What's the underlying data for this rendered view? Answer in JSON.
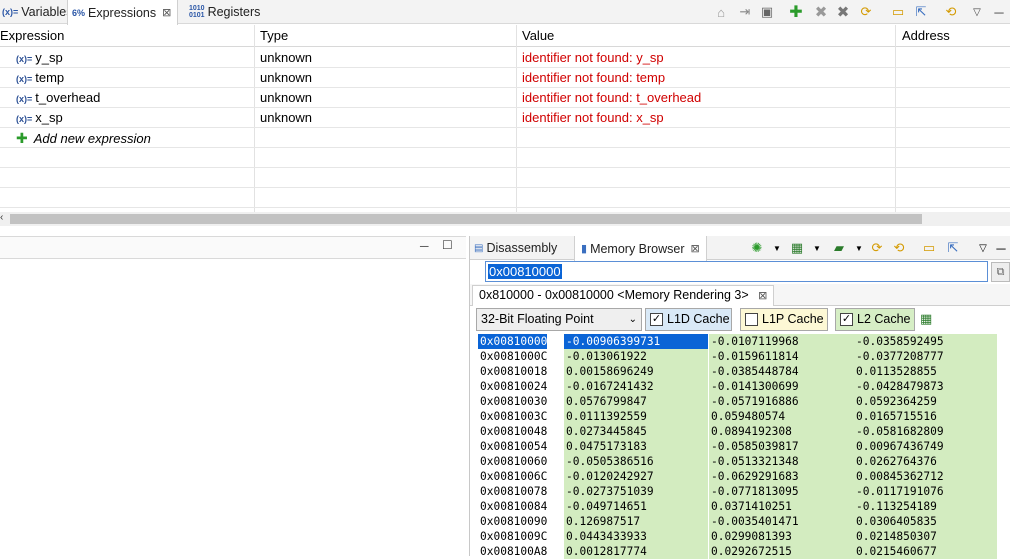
{
  "top_tabs": [
    {
      "label": "Variables"
    },
    {
      "label": "Expressions"
    },
    {
      "label": "Registers"
    }
  ],
  "expressions": {
    "columns": [
      "Expression",
      "Type",
      "Value",
      "Address"
    ],
    "rows": [
      {
        "name": "y_sp",
        "type": "unknown",
        "value": "identifier not found: y_sp"
      },
      {
        "name": "temp",
        "type": "unknown",
        "value": "identifier not found: temp"
      },
      {
        "name": "t_overhead",
        "type": "unknown",
        "value": "identifier not found: t_overhead"
      },
      {
        "name": "x_sp",
        "type": "unknown",
        "value": "identifier not found: x_sp"
      }
    ],
    "add_new": "Add new expression"
  },
  "memory": {
    "tabs": [
      {
        "label": "Disassembly"
      },
      {
        "label": "Memory Browser"
      }
    ],
    "address_input": "0x00810000",
    "rendering_tab": "0x810000 - 0x00810000 <Memory Rendering 3>",
    "format": "32-Bit Floating Point",
    "caches": [
      {
        "label": "L1D Cache",
        "checked": true
      },
      {
        "label": "L1P Cache",
        "checked": false
      },
      {
        "label": "L2 Cache",
        "checked": true
      }
    ],
    "rows": [
      {
        "addr": "0x00810000",
        "v": [
          "-0.00906399731",
          "-0.0107119968",
          "-0.0358592495"
        ]
      },
      {
        "addr": "0x0081000C",
        "v": [
          "-0.013061922",
          "-0.0159611814",
          "-0.0377208777"
        ]
      },
      {
        "addr": "0x00810018",
        "v": [
          "0.00158696249",
          "-0.0385448784",
          "0.0113528855"
        ]
      },
      {
        "addr": "0x00810024",
        "v": [
          "-0.0167241432",
          "-0.0141300699",
          "-0.0428479873"
        ]
      },
      {
        "addr": "0x00810030",
        "v": [
          "0.0576799847",
          "-0.0571916886",
          "0.0592364259"
        ]
      },
      {
        "addr": "0x0081003C",
        "v": [
          "0.0111392559",
          "0.059480574",
          "0.0165715516"
        ]
      },
      {
        "addr": "0x00810048",
        "v": [
          "0.0273445845",
          "0.0894192308",
          "-0.0581682809"
        ]
      },
      {
        "addr": "0x00810054",
        "v": [
          "0.0475173183",
          "-0.0585039817",
          "0.00967436749"
        ]
      },
      {
        "addr": "0x00810060",
        "v": [
          "-0.0505386516",
          "-0.0513321348",
          "0.0262764376"
        ]
      },
      {
        "addr": "0x0081006C",
        "v": [
          "-0.0120242927",
          "-0.0629291683",
          "0.00845362712"
        ]
      },
      {
        "addr": "0x00810078",
        "v": [
          "-0.0273751039",
          "-0.0771813095",
          "-0.0117191076"
        ]
      },
      {
        "addr": "0x00810084",
        "v": [
          "-0.049714651",
          "0.0371410251",
          "-0.113254189"
        ]
      },
      {
        "addr": "0x00810090",
        "v": [
          "0.126987517",
          "-0.0035401471",
          "0.0306405835"
        ]
      },
      {
        "addr": "0x0081009C",
        "v": [
          "0.0443433933",
          "0.0299081393",
          "0.0214850307"
        ]
      },
      {
        "addr": "0x008100A8",
        "v": [
          "0.0012817774",
          "0.0292672515",
          "0.0215460677"
        ]
      }
    ]
  }
}
